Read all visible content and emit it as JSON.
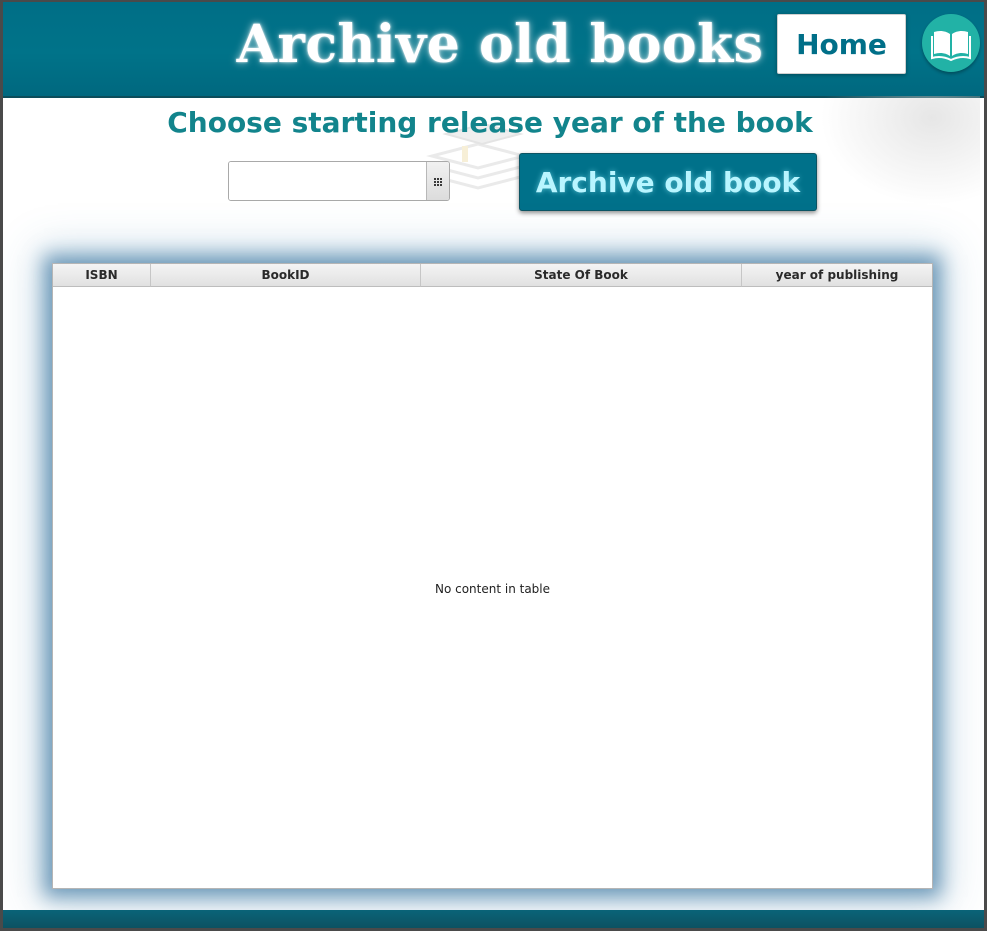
{
  "header": {
    "title": "Archive old books",
    "home_label": "Home",
    "logo_icon": "open-book-icon"
  },
  "form": {
    "prompt": "Choose starting release year of the book",
    "date_value": "",
    "calendar_icon": "calendar-icon",
    "archive_label": "Archive old book"
  },
  "table": {
    "columns": [
      "ISBN",
      "BookID",
      "State Of Book",
      "year of publishing"
    ],
    "rows": [],
    "empty_message": "No content in table"
  },
  "colors": {
    "header_bg": "#00738a",
    "accent_text": "#12848c",
    "button_bg": "#00718a",
    "logo_bg": "#22b2a6"
  }
}
